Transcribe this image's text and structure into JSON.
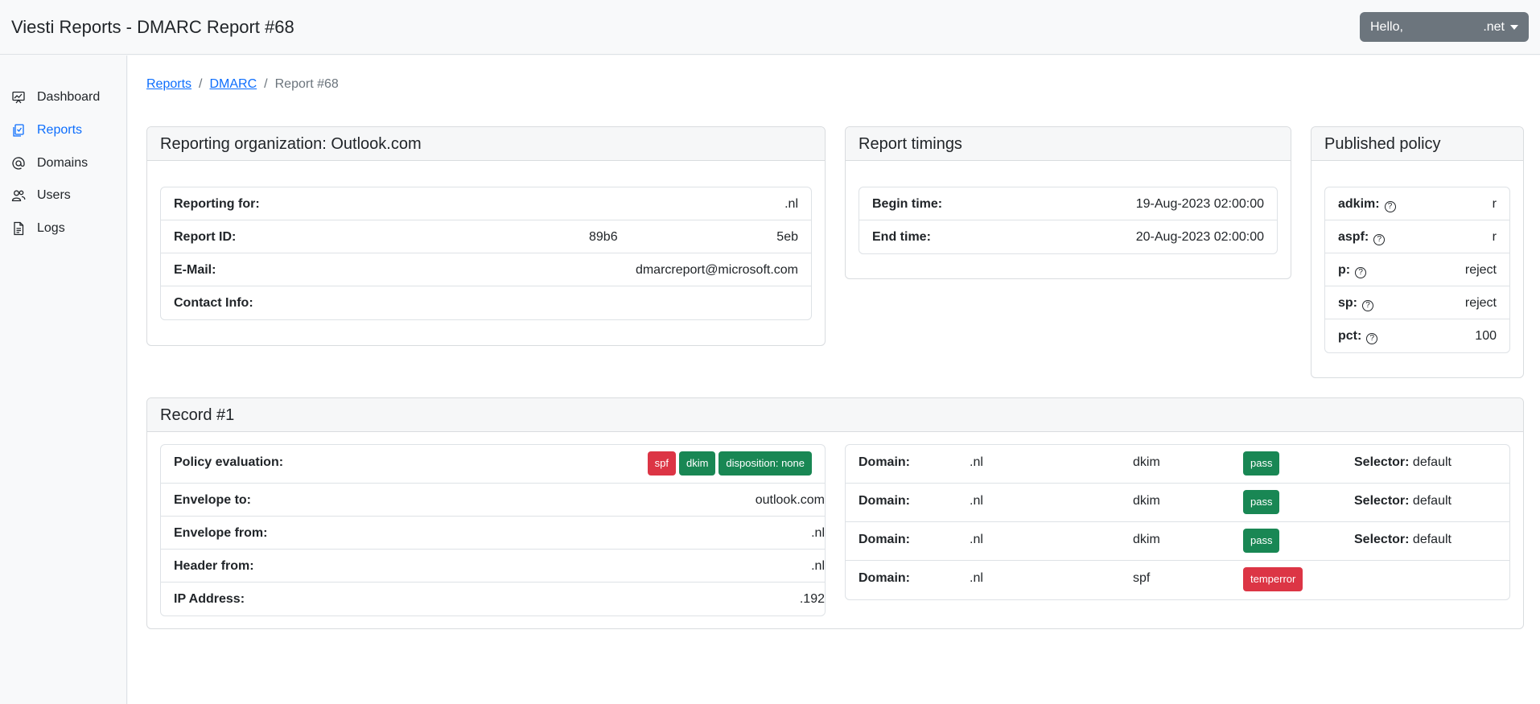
{
  "header": {
    "app_title": "Viesti Reports - DMARC Report #68",
    "user_greeting": "Hello,",
    "user_domain": ".net"
  },
  "sidebar": {
    "items": [
      {
        "label": "Dashboard",
        "icon": "dashboard-icon",
        "active": false
      },
      {
        "label": "Reports",
        "icon": "reports-icon",
        "active": true
      },
      {
        "label": "Domains",
        "icon": "at-icon",
        "active": false
      },
      {
        "label": "Users",
        "icon": "users-icon",
        "active": false
      },
      {
        "label": "Logs",
        "icon": "file-text-icon",
        "active": false
      }
    ]
  },
  "breadcrumb": {
    "items": [
      "Reports",
      "DMARC",
      "Report #68"
    ],
    "separator": "/"
  },
  "org_card": {
    "title": "Reporting organization: Outlook.com",
    "rows": [
      {
        "label": "Reporting for:",
        "value": ".nl"
      },
      {
        "label": "Report ID:",
        "value_left": "89b6",
        "value": "5eb"
      },
      {
        "label": "E-Mail:",
        "value": "dmarcreport@microsoft.com"
      },
      {
        "label": "Contact Info:",
        "value": ""
      }
    ]
  },
  "timings_card": {
    "title": "Report timings",
    "rows": [
      {
        "label": "Begin time:",
        "value": "19-Aug-2023 02:00:00"
      },
      {
        "label": "End time:",
        "value": "20-Aug-2023 02:00:00"
      }
    ]
  },
  "policy_card": {
    "title": "Published policy",
    "help_glyph": "?",
    "rows": [
      {
        "label": "adkim:",
        "value": "r"
      },
      {
        "label": "aspf:",
        "value": "r"
      },
      {
        "label": "p:",
        "value": "reject"
      },
      {
        "label": "sp:",
        "value": "reject"
      },
      {
        "label": "pct:",
        "value": "100"
      }
    ]
  },
  "record_card": {
    "title": "Record #1",
    "policy_evaluation": {
      "label": "Policy evaluation:",
      "badges": [
        {
          "text": "spf",
          "color": "#dc3545"
        },
        {
          "text": "dkim",
          "color": "#198754"
        },
        {
          "text": "disposition: none",
          "color": "#198754"
        }
      ]
    },
    "rows": [
      {
        "label": "Envelope to:",
        "value": "outlook.com"
      },
      {
        "label": "Envelope from:",
        "value": ".nl"
      },
      {
        "label": "Header from:",
        "value": ".nl"
      },
      {
        "label": "IP Address:",
        "value": ".192"
      }
    ],
    "auth_results": [
      {
        "label": "Domain:",
        "domain": ".nl",
        "type": "dkim",
        "result": "pass",
        "result_color": "#198754",
        "selector_label": "Selector:",
        "selector": "default"
      },
      {
        "label": "Domain:",
        "domain": ".nl",
        "type": "dkim",
        "result": "pass",
        "result_color": "#198754",
        "selector_label": "Selector:",
        "selector": "default"
      },
      {
        "label": "Domain:",
        "domain": ".nl",
        "type": "dkim",
        "result": "pass",
        "result_color": "#198754",
        "selector_label": "Selector:",
        "selector": "default"
      },
      {
        "label": "Domain:",
        "domain": ".nl",
        "type": "spf",
        "result": "temperror",
        "result_color": "#dc3545",
        "selector_label": "",
        "selector": ""
      }
    ]
  }
}
